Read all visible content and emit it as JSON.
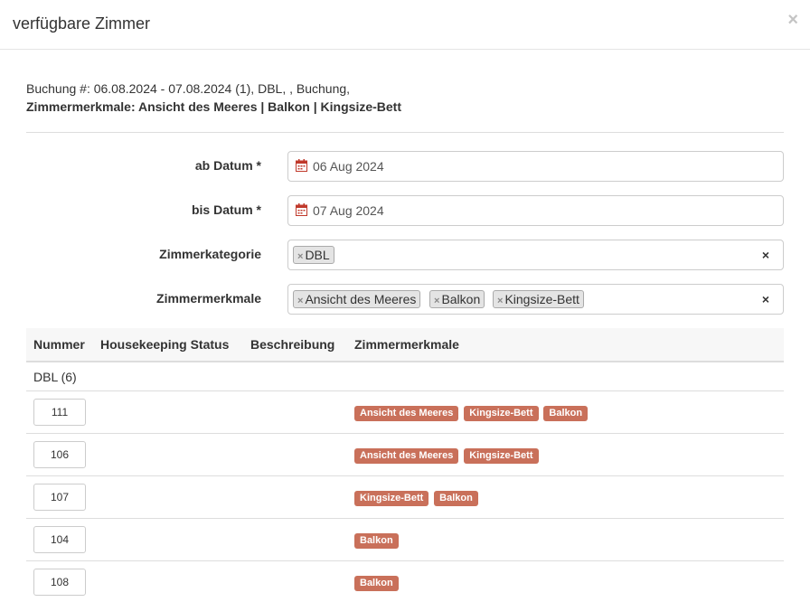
{
  "modal": {
    "title": "verfügbare Zimmer",
    "close_label": "×"
  },
  "booking": {
    "line1": "Buchung #: 06.08.2024 - 07.08.2024 (1), DBL, , Buchung,",
    "line2": "Zimmermerkmale: Ansicht des Meeres | Balkon | Kingsize-Bett"
  },
  "form": {
    "from_label": "ab Datum *",
    "from_value": "06 Aug 2024",
    "to_label": "bis Datum *",
    "to_value": "07 Aug 2024",
    "category_label": "Zimmerkategorie",
    "category_tags": [
      "DBL"
    ],
    "features_label": "Zimmermerkmale",
    "feature_tags": [
      "Ansicht des Meeres",
      "Balkon",
      "Kingsize-Bett"
    ],
    "tag_remove": "×",
    "clear": "×"
  },
  "table": {
    "headers": [
      "Nummer",
      "Housekeeping Status",
      "Beschreibung",
      "Zimmermerkmale"
    ],
    "group": "DBL (6)",
    "rows": [
      {
        "number": "111",
        "features": [
          "Ansicht des Meeres",
          "Kingsize-Bett",
          "Balkon"
        ]
      },
      {
        "number": "106",
        "features": [
          "Ansicht des Meeres",
          "Kingsize-Bett"
        ]
      },
      {
        "number": "107",
        "features": [
          "Kingsize-Bett",
          "Balkon"
        ]
      },
      {
        "number": "104",
        "features": [
          "Balkon"
        ]
      },
      {
        "number": "108",
        "features": [
          "Balkon"
        ]
      }
    ]
  },
  "colors": {
    "badge": "#c9705a",
    "calendar_icon": "#c0392b"
  }
}
